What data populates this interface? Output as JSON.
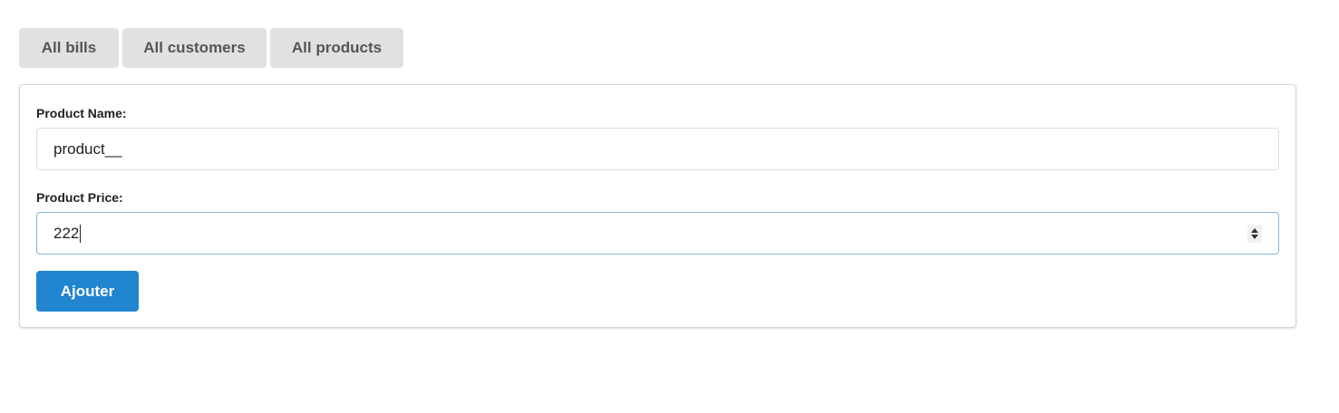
{
  "nav": {
    "items": [
      {
        "label": "All bills"
      },
      {
        "label": "All customers"
      },
      {
        "label": "All products"
      }
    ]
  },
  "form": {
    "product_name": {
      "label": "Product Name:",
      "value": "product__"
    },
    "product_price": {
      "label": "Product Price:",
      "value": "222"
    },
    "submit_label": "Ajouter"
  },
  "colors": {
    "primary": "#2185d0",
    "nav_bg": "#e0e1e2",
    "focus_border": "#85b7d9"
  }
}
